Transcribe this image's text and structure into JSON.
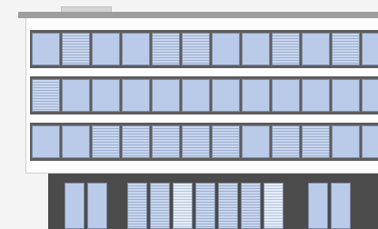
{
  "image": {
    "subject": "office-building-facade",
    "colors": {
      "background": "#f4f4f4",
      "facade": "#fdfdfd",
      "roof": "#9e9e9e",
      "window_frame": "#5d5d5d",
      "glass": "#b9cbe9",
      "blind_slat": "#9fb1cf",
      "ground_floor": "#4b4b4b"
    },
    "upper_floors": [
      {
        "blinds": [
          false,
          true,
          false,
          false,
          true,
          true,
          false,
          false,
          true,
          false,
          true,
          false
        ]
      },
      {
        "blinds": [
          true,
          false,
          false,
          false,
          false,
          false,
          false,
          false,
          false,
          false,
          false,
          false
        ]
      },
      {
        "blinds": [
          false,
          false,
          true,
          true,
          true,
          true,
          true,
          false,
          true,
          true,
          false,
          false
        ]
      }
    ],
    "ground_floor": {
      "windows": [
        "plain",
        "plain",
        "blind",
        "blind",
        "light",
        "blind",
        "blind",
        "blind",
        "light",
        "plain",
        "plain"
      ]
    }
  }
}
